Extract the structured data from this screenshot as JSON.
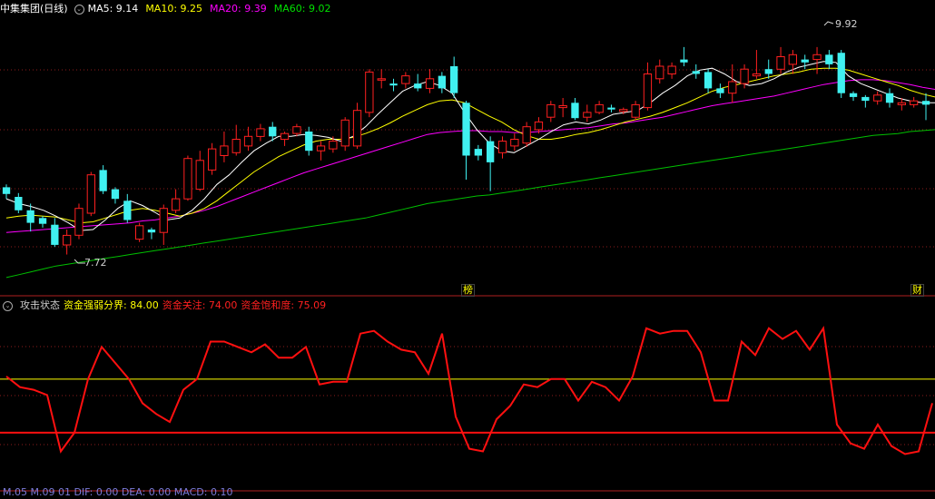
{
  "stock": {
    "name": "中集集团(日线)"
  },
  "ma": {
    "ma5_label": "MA5: 9.14",
    "ma10_label": "MA10: 9.25",
    "ma20_label": "MA20: 9.39",
    "ma60_label": "MA60: 9.02",
    "ma5_color": "#ffffff",
    "ma10_color": "#ffff00",
    "ma20_color": "#ff00ff",
    "ma60_color": "#00c000"
  },
  "annotations": {
    "high_label": "9.92",
    "low_label": "7.72",
    "marker_bang": "榜",
    "marker_cai": "财"
  },
  "indicator": {
    "name": "攻击状态",
    "threshold_label": "资金强弱分界: 84.00",
    "focus_label": "资金关注: 74.00",
    "saturation_label": "资金饱和度: 75.09",
    "bottom_text": "M.05 M.09 01 DIF: 0.00 DEA: 0.00 MACD: 0.10"
  },
  "colors": {
    "up": "#ff2020",
    "down": "#40f0f0",
    "grid": "#8b1c1c",
    "line": "#ff1010",
    "threshold": "#ffff00"
  },
  "chart_data": [
    {
      "type": "candlestick",
      "title": "中集集团(日线)",
      "ylim": [
        7.3,
        10.2
      ],
      "candles": [
        {
          "o": 8.42,
          "c": 8.35,
          "h": 8.45,
          "l": 8.3
        },
        {
          "o": 8.32,
          "c": 8.18,
          "h": 8.36,
          "l": 8.15
        },
        {
          "o": 8.18,
          "c": 8.05,
          "h": 8.25,
          "l": 7.96
        },
        {
          "o": 8.1,
          "c": 8.04,
          "h": 8.12,
          "l": 8.0
        },
        {
          "o": 8.03,
          "c": 7.82,
          "h": 8.1,
          "l": 7.8
        },
        {
          "o": 7.82,
          "c": 7.92,
          "h": 7.98,
          "l": 7.72
        },
        {
          "o": 7.92,
          "c": 8.2,
          "h": 8.25,
          "l": 7.88
        },
        {
          "o": 8.15,
          "c": 8.55,
          "h": 8.58,
          "l": 8.12
        },
        {
          "o": 8.6,
          "c": 8.38,
          "h": 8.65,
          "l": 8.35
        },
        {
          "o": 8.4,
          "c": 8.3,
          "h": 8.42,
          "l": 8.25
        },
        {
          "o": 8.28,
          "c": 8.08,
          "h": 8.35,
          "l": 8.05
        },
        {
          "o": 7.88,
          "c": 8.02,
          "h": 8.05,
          "l": 7.85
        },
        {
          "o": 7.98,
          "c": 7.95,
          "h": 8.0,
          "l": 7.88
        },
        {
          "o": 7.95,
          "c": 8.2,
          "h": 8.24,
          "l": 7.82
        },
        {
          "o": 8.18,
          "c": 8.3,
          "h": 8.4,
          "l": 8.15
        },
        {
          "o": 8.3,
          "c": 8.72,
          "h": 8.75,
          "l": 8.28
        },
        {
          "o": 8.4,
          "c": 8.7,
          "h": 8.8,
          "l": 8.38
        },
        {
          "o": 8.6,
          "c": 8.82,
          "h": 8.88,
          "l": 8.55
        },
        {
          "o": 8.75,
          "c": 8.85,
          "h": 9.0,
          "l": 8.68
        },
        {
          "o": 8.78,
          "c": 8.92,
          "h": 9.07,
          "l": 8.75
        },
        {
          "o": 8.85,
          "c": 8.95,
          "h": 9.05,
          "l": 8.8
        },
        {
          "o": 8.95,
          "c": 9.03,
          "h": 9.08,
          "l": 8.9
        },
        {
          "o": 9.05,
          "c": 8.95,
          "h": 9.1,
          "l": 8.9
        },
        {
          "o": 8.92,
          "c": 8.98,
          "h": 9.0,
          "l": 8.85
        },
        {
          "o": 8.98,
          "c": 9.05,
          "h": 9.08,
          "l": 8.95
        },
        {
          "o": 9.0,
          "c": 8.8,
          "h": 9.05,
          "l": 8.75
        },
        {
          "o": 8.8,
          "c": 8.85,
          "h": 8.9,
          "l": 8.7
        },
        {
          "o": 8.82,
          "c": 8.9,
          "h": 8.95,
          "l": 8.78
        },
        {
          "o": 8.85,
          "c": 9.12,
          "h": 9.15,
          "l": 8.8
        },
        {
          "o": 8.85,
          "c": 9.22,
          "h": 9.3,
          "l": 8.82
        },
        {
          "o": 9.2,
          "c": 9.62,
          "h": 9.65,
          "l": 9.15
        },
        {
          "o": 9.55,
          "c": 9.55,
          "h": 9.65,
          "l": 9.45
        },
        {
          "o": 9.5,
          "c": 9.48,
          "h": 9.55,
          "l": 9.42
        },
        {
          "o": 9.5,
          "c": 9.58,
          "h": 9.62,
          "l": 9.45
        },
        {
          "o": 9.5,
          "c": 9.45,
          "h": 9.6,
          "l": 9.42
        },
        {
          "o": 9.45,
          "c": 9.55,
          "h": 9.65,
          "l": 9.4
        },
        {
          "o": 9.58,
          "c": 9.45,
          "h": 9.62,
          "l": 9.4
        },
        {
          "o": 9.68,
          "c": 9.4,
          "h": 9.78,
          "l": 9.35
        },
        {
          "o": 9.3,
          "c": 8.75,
          "h": 9.32,
          "l": 8.5
        },
        {
          "o": 8.82,
          "c": 8.75,
          "h": 8.86,
          "l": 8.7
        },
        {
          "o": 8.9,
          "c": 8.68,
          "h": 8.95,
          "l": 8.38
        },
        {
          "o": 8.78,
          "c": 8.9,
          "h": 8.95,
          "l": 8.72
        },
        {
          "o": 8.85,
          "c": 8.92,
          "h": 8.98,
          "l": 8.8
        },
        {
          "o": 8.88,
          "c": 9.05,
          "h": 9.1,
          "l": 8.84
        },
        {
          "o": 9.02,
          "c": 9.1,
          "h": 9.15,
          "l": 8.98
        },
        {
          "o": 9.15,
          "c": 9.28,
          "h": 9.32,
          "l": 9.1
        },
        {
          "o": 9.25,
          "c": 9.27,
          "h": 9.35,
          "l": 9.15
        },
        {
          "o": 9.3,
          "c": 9.14,
          "h": 9.35,
          "l": 9.12
        },
        {
          "o": 9.15,
          "c": 9.2,
          "h": 9.28,
          "l": 9.1
        },
        {
          "o": 9.2,
          "c": 9.28,
          "h": 9.32,
          "l": 9.18
        },
        {
          "o": 9.25,
          "c": 9.23,
          "h": 9.28,
          "l": 9.2
        },
        {
          "o": 9.21,
          "c": 9.23,
          "h": 9.25,
          "l": 9.18
        },
        {
          "o": 9.15,
          "c": 9.28,
          "h": 9.32,
          "l": 9.12
        },
        {
          "o": 9.25,
          "c": 9.6,
          "h": 9.72,
          "l": 9.22
        },
        {
          "o": 9.55,
          "c": 9.68,
          "h": 9.75,
          "l": 9.5
        },
        {
          "o": 9.6,
          "c": 9.68,
          "h": 9.72,
          "l": 9.55
        },
        {
          "o": 9.75,
          "c": 9.72,
          "h": 9.88,
          "l": 9.68
        },
        {
          "o": 9.63,
          "c": 9.6,
          "h": 9.7,
          "l": 9.55
        },
        {
          "o": 9.62,
          "c": 9.45,
          "h": 9.65,
          "l": 9.4
        },
        {
          "o": 9.45,
          "c": 9.4,
          "h": 9.5,
          "l": 9.35
        },
        {
          "o": 9.4,
          "c": 9.52,
          "h": 9.7,
          "l": 9.3
        },
        {
          "o": 9.5,
          "c": 9.65,
          "h": 9.7,
          "l": 9.45
        },
        {
          "o": 9.58,
          "c": 9.6,
          "h": 9.85,
          "l": 9.55
        },
        {
          "o": 9.65,
          "c": 9.6,
          "h": 9.75,
          "l": 9.55
        },
        {
          "o": 9.65,
          "c": 9.78,
          "h": 9.88,
          "l": 9.6
        },
        {
          "o": 9.7,
          "c": 9.8,
          "h": 9.85,
          "l": 9.6
        },
        {
          "o": 9.75,
          "c": 9.72,
          "h": 9.8,
          "l": 9.65
        },
        {
          "o": 9.75,
          "c": 9.8,
          "h": 9.88,
          "l": 9.6
        },
        {
          "o": 9.8,
          "c": 9.7,
          "h": 9.85,
          "l": 9.65
        },
        {
          "o": 9.82,
          "c": 9.4,
          "h": 9.85,
          "l": 9.35
        },
        {
          "o": 9.4,
          "c": 9.36,
          "h": 9.42,
          "l": 9.32
        },
        {
          "o": 9.36,
          "c": 9.32,
          "h": 9.38,
          "l": 9.25
        },
        {
          "o": 9.32,
          "c": 9.38,
          "h": 9.42,
          "l": 9.28
        },
        {
          "o": 9.4,
          "c": 9.3,
          "h": 9.45,
          "l": 9.25
        },
        {
          "o": 9.28,
          "c": 9.3,
          "h": 9.35,
          "l": 9.22
        },
        {
          "o": 9.28,
          "c": 9.32,
          "h": 9.36,
          "l": 9.25
        },
        {
          "o": 9.32,
          "c": 9.28,
          "h": 9.4,
          "l": 9.12
        }
      ],
      "ma5": [
        8.3,
        8.25,
        8.22,
        8.18,
        8.12,
        8.05,
        7.97,
        7.98,
        8.08,
        8.2,
        8.28,
        8.23,
        8.16,
        8.08,
        8.1,
        8.18,
        8.3,
        8.45,
        8.55,
        8.68,
        8.8,
        8.88,
        8.95,
        8.95,
        8.97,
        8.96,
        8.94,
        8.9,
        8.95,
        9.05,
        9.18,
        9.3,
        9.42,
        9.48,
        9.52,
        9.48,
        9.4,
        9.2,
        9.02,
        8.88,
        8.8,
        8.78,
        8.85,
        8.92,
        9.0,
        9.07,
        9.1,
        9.08,
        9.12,
        9.18,
        9.2,
        9.22,
        9.3,
        9.4,
        9.48,
        9.58,
        9.64,
        9.66,
        9.6,
        9.52,
        9.48,
        9.5,
        9.55,
        9.62,
        9.67,
        9.7,
        9.73,
        9.72,
        9.58,
        9.5,
        9.45,
        9.4,
        9.35,
        9.32,
        9.3,
        9.3
      ],
      "ma10": [
        8.1,
        8.12,
        8.13,
        8.12,
        8.11,
        8.08,
        8.05,
        8.06,
        8.1,
        8.14,
        8.18,
        8.2,
        8.18,
        8.15,
        8.12,
        8.15,
        8.2,
        8.28,
        8.38,
        8.48,
        8.58,
        8.66,
        8.74,
        8.8,
        8.86,
        8.9,
        8.92,
        8.92,
        8.94,
        8.98,
        9.03,
        9.09,
        9.16,
        9.22,
        9.28,
        9.32,
        9.33,
        9.3,
        9.23,
        9.16,
        9.1,
        9.02,
        8.96,
        8.92,
        8.92,
        8.94,
        8.97,
        8.99,
        9.02,
        9.06,
        9.1,
        9.13,
        9.16,
        9.2,
        9.25,
        9.3,
        9.36,
        9.42,
        9.46,
        9.49,
        9.52,
        9.55,
        9.58,
        9.6,
        9.62,
        9.65,
        9.66,
        9.66,
        9.64,
        9.6,
        9.56,
        9.52,
        9.48,
        9.43,
        9.39,
        9.36
      ],
      "ma20": [
        7.95,
        7.96,
        7.97,
        7.98,
        7.99,
        8.0,
        8.01,
        8.02,
        8.03,
        8.04,
        8.05,
        8.07,
        8.08,
        8.1,
        8.12,
        8.15,
        8.18,
        8.22,
        8.27,
        8.32,
        8.37,
        8.42,
        8.47,
        8.52,
        8.57,
        8.61,
        8.65,
        8.69,
        8.73,
        8.77,
        8.81,
        8.85,
        8.89,
        8.93,
        8.97,
        8.99,
        9.0,
        9.01,
        9.01,
        9.0,
        9.0,
        8.99,
        8.99,
        9.0,
        9.01,
        9.02,
        9.03,
        9.04,
        9.06,
        9.08,
        9.09,
        9.11,
        9.13,
        9.15,
        9.18,
        9.21,
        9.24,
        9.27,
        9.29,
        9.31,
        9.33,
        9.35,
        9.37,
        9.4,
        9.43,
        9.46,
        9.49,
        9.51,
        9.53,
        9.54,
        9.54,
        9.53,
        9.51,
        9.49,
        9.46,
        9.44
      ],
      "ma60": [
        7.48,
        7.51,
        7.54,
        7.57,
        7.6,
        7.62,
        7.64,
        7.66,
        7.68,
        7.7,
        7.72,
        7.74,
        7.76,
        7.78,
        7.8,
        7.82,
        7.84,
        7.86,
        7.88,
        7.9,
        7.92,
        7.94,
        7.96,
        7.98,
        8.0,
        8.02,
        8.04,
        8.06,
        8.08,
        8.1,
        8.13,
        8.16,
        8.19,
        8.22,
        8.25,
        8.27,
        8.29,
        8.31,
        8.33,
        8.34,
        8.36,
        8.38,
        8.4,
        8.42,
        8.44,
        8.46,
        8.48,
        8.5,
        8.52,
        8.54,
        8.56,
        8.58,
        8.6,
        8.62,
        8.64,
        8.66,
        8.68,
        8.7,
        8.72,
        8.74,
        8.76,
        8.78,
        8.8,
        8.82,
        8.84,
        8.86,
        8.88,
        8.9,
        8.92,
        8.94,
        8.96,
        8.97,
        8.98,
        9.0,
        9.01,
        9.02
      ]
    },
    {
      "type": "line",
      "title": "攻击状态",
      "ylim": [
        65,
        96
      ],
      "series": [
        {
          "name": "攻击状态",
          "values": [
            84.5,
            82.5,
            82.0,
            81.0,
            70.5,
            74.0,
            84.0,
            90.0,
            87.0,
            84.0,
            79.5,
            77.5,
            76.0,
            82.0,
            84.0,
            91.0,
            91.0,
            90.0,
            89.0,
            90.5,
            88.0,
            88.0,
            90.0,
            83.0,
            83.5,
            83.5,
            92.5,
            93.0,
            91.0,
            89.5,
            89.0,
            85.0,
            92.5,
            77.0,
            71.0,
            70.5,
            76.5,
            79.0,
            83.0,
            82.5,
            84.0,
            84.0,
            80.0,
            83.5,
            82.5,
            80.0,
            84.5,
            93.5,
            92.5,
            93.0,
            93.0,
            89.0,
            80.0,
            80.0,
            91.0,
            88.5,
            93.5,
            91.5,
            93.0,
            89.5,
            93.5,
            75.5,
            72.0,
            71.0,
            75.5,
            71.5,
            70.0,
            70.5,
            79.5
          ]
        },
        {
          "name": "资金强弱分界",
          "values": [
            84.0
          ]
        },
        {
          "name": "资金关注",
          "values": [
            74.0
          ]
        }
      ]
    }
  ]
}
